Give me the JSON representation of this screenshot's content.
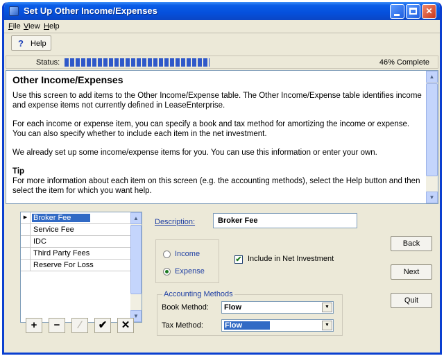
{
  "window": {
    "title": "Set Up Other Income/Expenses"
  },
  "menu": {
    "items": [
      "File",
      "View",
      "Help"
    ]
  },
  "toolbar": {
    "help_label": "Help",
    "help_glyph": "?"
  },
  "status": {
    "label": "Status:",
    "percent_text": "46% Complete",
    "progress_fraction": 0.46
  },
  "help_panel": {
    "title": "Other Income/Expenses",
    "paragraphs": [
      "Use this screen to add items to the Other Income/Expense table.  The Other Income/Expense table identifies income and expense items not currently defined in LeaseEnterprise.",
      "For each income or expense item, you can specify a book and tax method for amortizing the income or expense.  You can also specify whether to include each item in the net investment.",
      "We already set up some income/expense items for you.  You can use this information or enter your own."
    ],
    "tip_heading": "Tip",
    "tip_text": "For more information about each item on this screen (e.g. the accounting methods), select the Help button and then select the item for which you want help."
  },
  "items_list": {
    "rows": [
      {
        "label": "Broker Fee",
        "selected": true
      },
      {
        "label": "Service Fee",
        "selected": false
      },
      {
        "label": "IDC",
        "selected": false
      },
      {
        "label": "Third Party Fees",
        "selected": false
      },
      {
        "label": "Reserve For Loss",
        "selected": false
      }
    ],
    "tools": [
      "+",
      "−",
      "∕",
      "✔",
      "✕"
    ]
  },
  "form": {
    "description_label": "Description:",
    "description_value": "Broker Fee",
    "income_label": "Income",
    "expense_label": "Expense",
    "selected_type": "Expense",
    "include_net_label": "Include in Net Investment",
    "include_net_checked": true,
    "accounting_legend": "Accounting Methods",
    "book_method_label": "Book Method:",
    "book_method_value": "Flow",
    "tax_method_label": "Tax Method:",
    "tax_method_value": "Flow"
  },
  "buttons": {
    "back": "Back",
    "next": "Next",
    "quit": "Quit"
  },
  "colors": {
    "title_bar": "#0550dc",
    "selection": "#316ac5",
    "progress": "#2f58c9",
    "field_label": "#1f3fa3"
  }
}
